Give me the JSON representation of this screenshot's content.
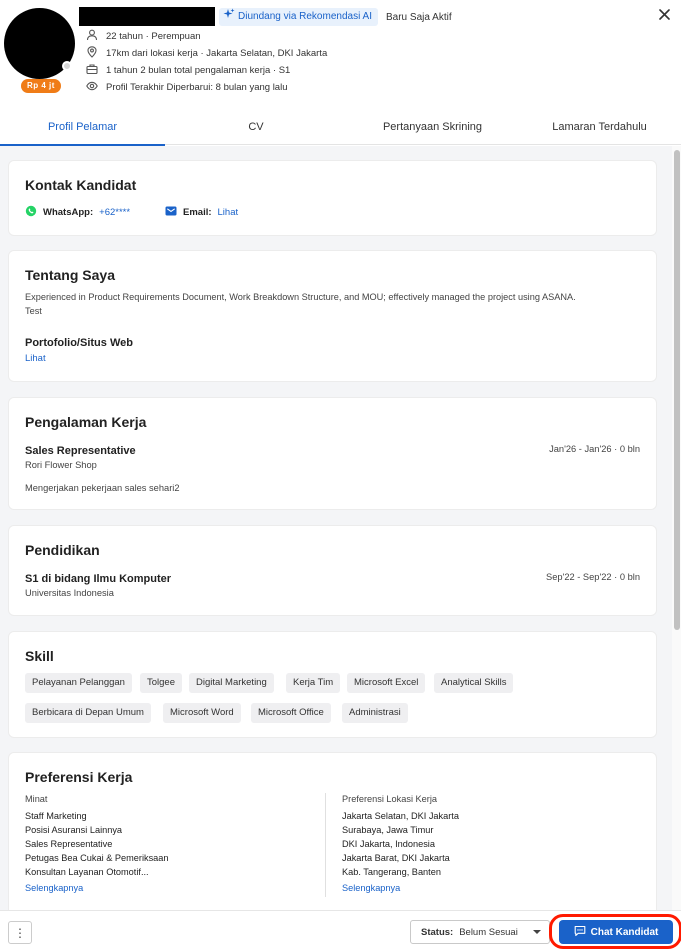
{
  "header": {
    "salary_badge": "Rp 4 jt",
    "ai_badge": "Diundang via Rekomendasi AI",
    "active_status": "Baru Saja Aktif",
    "age_gender": "22 tahun · Perempuan",
    "location": "17km dari lokasi kerja · Jakarta Selatan, DKI Jakarta",
    "experience": "1 tahun 2 bulan total pengalaman kerja · S1",
    "updated": "Profil Terakhir Diperbarui: 8 bulan yang lalu"
  },
  "tabs": [
    {
      "label": "Profil Pelamar"
    },
    {
      "label": "CV"
    },
    {
      "label": "Pertanyaan Skrining"
    },
    {
      "label": "Lamaran Terdahulu"
    }
  ],
  "contact": {
    "title": "Kontak Kandidat",
    "whatsapp_label": "WhatsApp:",
    "whatsapp_value": "+62****",
    "email_label": "Email:",
    "email_value": "Lihat"
  },
  "about": {
    "title": "Tentang Saya",
    "text_line1": "Experienced in Product Requirements Document, Work Breakdown Structure, and MOU; effectively managed the project using ASANA.",
    "text_line2": "Test",
    "portfolio_title": "Portofolio/Situs Web",
    "portfolio_link": "Lihat"
  },
  "experience": {
    "title": "Pengalaman Kerja",
    "role": "Sales Representative",
    "company": "Rori Flower Shop",
    "period": "Jan'26 - Jan'26 · 0 bln",
    "description": "Mengerjakan pekerjaan sales sehari2"
  },
  "education": {
    "title": "Pendidikan",
    "degree": "S1 di bidang Ilmu Komputer",
    "school": "Universitas Indonesia",
    "period": "Sep'22 - Sep'22 · 0 bln"
  },
  "skills": {
    "title": "Skill",
    "items": [
      "Pelayanan Pelanggan",
      "Tolgee",
      "Digital Marketing",
      "Kerja Tim",
      "Microsoft Excel",
      "Analytical Skills",
      "Berbicara di Depan Umum",
      "Microsoft Word",
      "Microsoft Office",
      "Administrasi"
    ]
  },
  "preferences": {
    "title": "Preferensi Kerja",
    "interest_label": "Minat",
    "interests": [
      "Staff Marketing",
      "Posisi Asuransi Lainnya",
      "Sales Representative",
      "Petugas Bea Cukai & Pemeriksaan",
      "Konsultan Layanan Otomotif..."
    ],
    "interest_more": "Selengkapnya",
    "location_label": "Preferensi Lokasi Kerja",
    "locations": [
      "Jakarta Selatan, DKI Jakarta",
      "Surabaya, Jawa Timur",
      "DKI Jakarta, Indonesia",
      "Jakarta Barat, DKI Jakarta",
      "Kab. Tangerang, Banten"
    ],
    "location_more": "Selengkapnya"
  },
  "footer": {
    "more_label": "⋮",
    "status_label": "Status:",
    "status_value": "Belum Sesuai",
    "chat_button": "Chat Kandidat"
  },
  "colors": {
    "accent": "#1a62c9",
    "salary_badge": "#f07c17",
    "highlight": "#ff1a00",
    "whatsapp": "#25d366"
  }
}
